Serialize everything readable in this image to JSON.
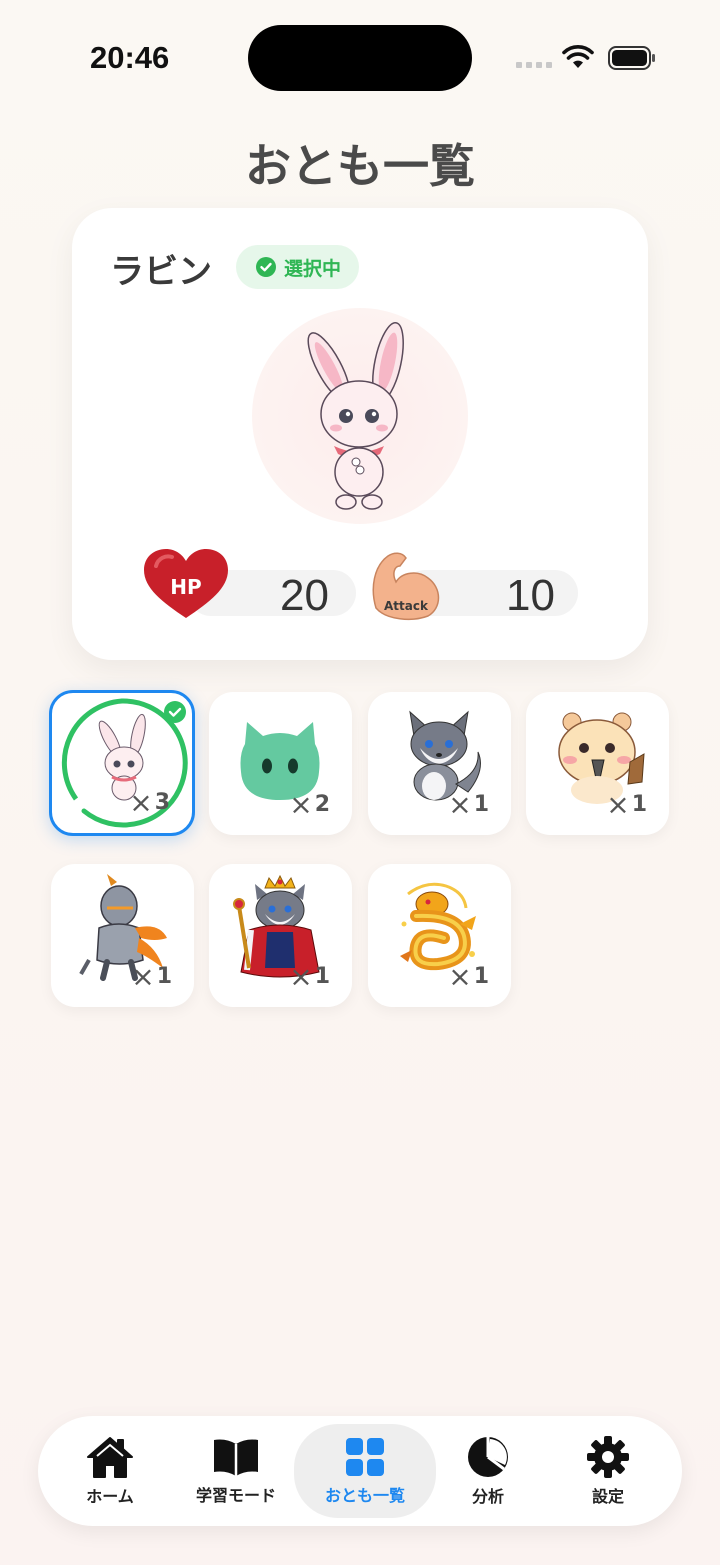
{
  "status_bar": {
    "time": "20:46"
  },
  "page": {
    "title": "おとも一覧"
  },
  "selected_pet": {
    "name": "ラビン",
    "badge": "選択中",
    "hp_icon_label": "HP",
    "hp": "20",
    "attack_icon_label": "Attack",
    "attack": "10"
  },
  "pets": [
    {
      "name": "bunny",
      "count": "3",
      "selected": true
    },
    {
      "name": "green-slime",
      "count": "2",
      "selected": false
    },
    {
      "name": "wolf-pup",
      "count": "1",
      "selected": false
    },
    {
      "name": "hamster",
      "count": "1",
      "selected": false
    },
    {
      "name": "armored-knight",
      "count": "1",
      "selected": false
    },
    {
      "name": "king-cat",
      "count": "1",
      "selected": false
    },
    {
      "name": "golden-dragon",
      "count": "1",
      "selected": false
    }
  ],
  "tabbar": {
    "items": [
      {
        "label": "ホーム",
        "icon": "home-icon"
      },
      {
        "label": "学習モード",
        "icon": "book-icon"
      },
      {
        "label": "おとも一覧",
        "icon": "grid-icon",
        "active": true
      },
      {
        "label": "分析",
        "icon": "pie-chart-icon"
      },
      {
        "label": "設定",
        "icon": "gear-icon"
      }
    ]
  },
  "colors": {
    "accent": "#1e88f0",
    "selected_green": "#2fb654",
    "hp_red": "#c8202a",
    "arm_skin": "#f3b28c"
  }
}
